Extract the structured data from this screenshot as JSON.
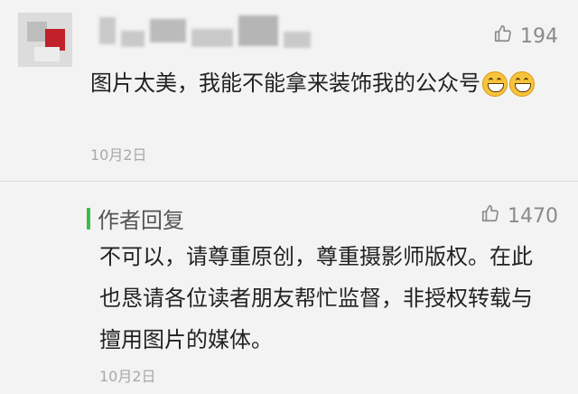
{
  "comment": {
    "text": "图片太美，我能不能拿来装饰我的公众号",
    "likes": "194",
    "date": "10月2日",
    "emojis": [
      "grin-emoji",
      "grin-emoji"
    ]
  },
  "reply": {
    "title": "作者回复",
    "likes": "1470",
    "text": "不可以，请尊重原创，尊重摄影师版权。在此也恳请各位读者朋友帮忙监督，非授权转载与擅用图片的媒体。",
    "date": "10月2日"
  },
  "colors": {
    "accent_bar": "#3dbb49",
    "text": "#222222",
    "muted": "#8a8a8a",
    "background": "#f3f3f3"
  },
  "icons": {
    "like": "thumbs-up-icon"
  }
}
